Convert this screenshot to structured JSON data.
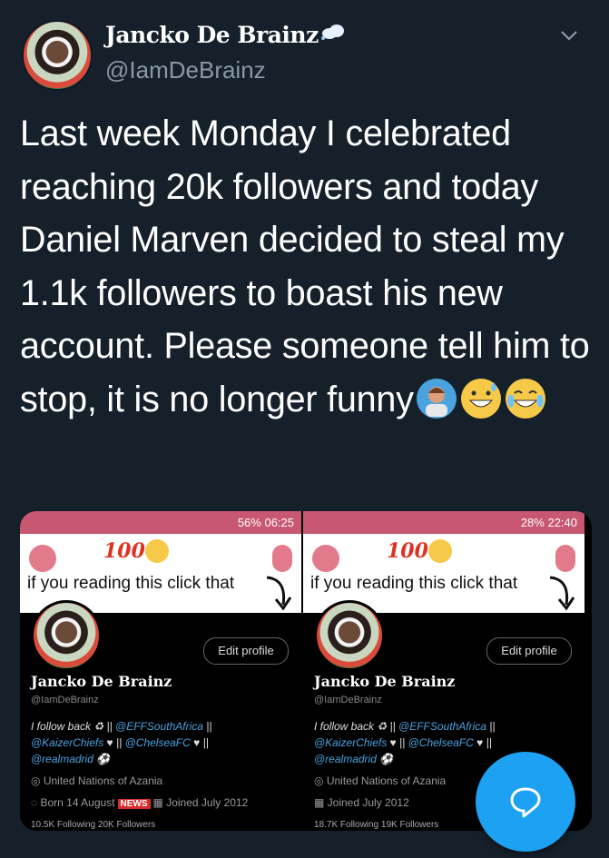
{
  "tweet": {
    "display_name": "Jancko De Brainz",
    "handle": "@IamDeBrainz",
    "text": "Last week Monday I celebrated reaching 20k followers and today Daniel Marven decided to steal my 1.1k followers to boast his new account. Please someone tell him to stop, it is no longer funny",
    "emojis": [
      "man-gesturing-no-icon",
      "grinning-sweat-icon",
      "tears-of-joy-icon"
    ]
  },
  "screenshots": [
    {
      "status": "56% 06:25",
      "score_text": "100",
      "overlay_text": "if you reading this click that",
      "edit_label": "Edit profile",
      "profile_name": "Jancko De Brainz",
      "profile_handle": "@IamDeBrainz",
      "bio_line1": "I follow back",
      "bio_m1": "@EFFSouthAfrica",
      "bio_m2": "@KaizerChiefs",
      "bio_m3": "@ChelseaFC",
      "bio_m4": "@realmadrid",
      "location": "United Nations of Azania",
      "born": "Born 14 August",
      "news": "NEWS",
      "joined": "Joined July 2012",
      "follow_strip": "10.5K Following  20K Followers"
    },
    {
      "status": "28% 22:40",
      "score_text": "100",
      "overlay_text": "if you reading this click that",
      "edit_label": "Edit profile",
      "profile_name": "Jancko De Brainz",
      "profile_handle": "@IamDeBrainz",
      "bio_line1": "I follow back",
      "bio_m1": "@EFFSouthAfrica",
      "bio_m2": "@KaizerChiefs",
      "bio_m3": "@ChelseaFC",
      "bio_m4": "@realmadrid",
      "location": "United Nations of Azania",
      "joined": "Joined July 2012",
      "follow_strip": "18.7K Following  19K Followers"
    }
  ],
  "colors": {
    "background": "#15202b",
    "accent": "#1da1f2",
    "muted": "#8899a6"
  },
  "fab": {
    "icon": "compose-reply-icon"
  }
}
